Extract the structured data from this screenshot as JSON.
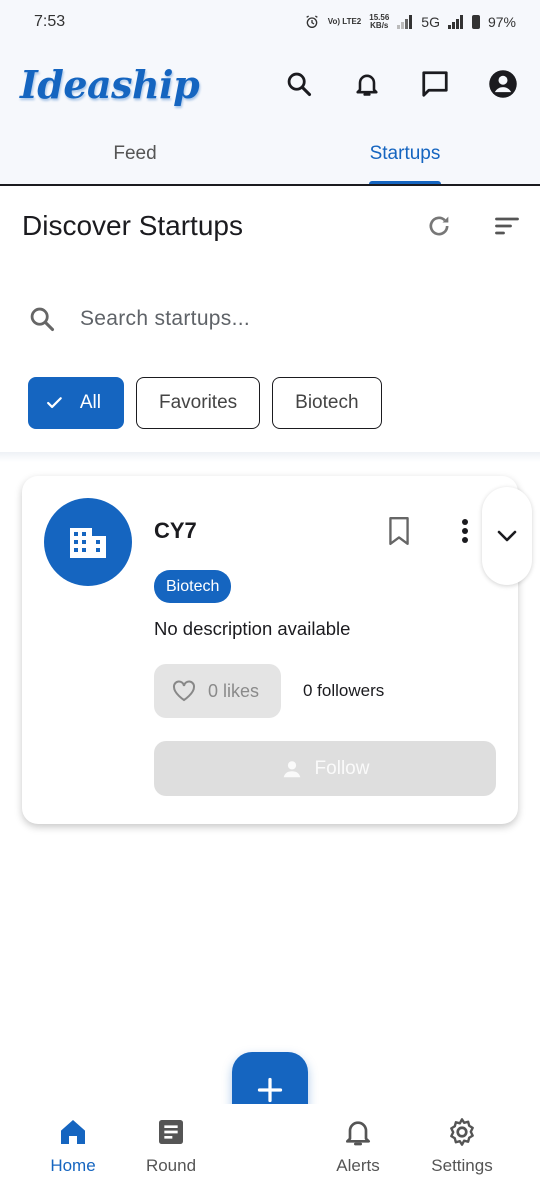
{
  "status_bar": {
    "time": "7:53",
    "network_label": "Vo) LTE2",
    "speed": "15.56",
    "speed_unit": "KB/s",
    "network_type": "5G",
    "battery": "97%"
  },
  "app": {
    "logo": "Ideaship",
    "actions": [
      "search-icon",
      "bell-icon",
      "chat-icon",
      "account-icon"
    ]
  },
  "tabs": [
    {
      "label": "Feed",
      "active": false
    },
    {
      "label": "Startups",
      "active": true
    }
  ],
  "page": {
    "title": "Discover Startups"
  },
  "search": {
    "placeholder": "Search startups..."
  },
  "filters": [
    {
      "label": "All",
      "selected": true
    },
    {
      "label": "Favorites",
      "selected": false
    },
    {
      "label": "Biotech",
      "selected": false
    }
  ],
  "startup_card": {
    "name": "CY7",
    "tag": "Biotech",
    "description": "No description available",
    "likes": "0 likes",
    "followers": "0 followers",
    "follow_label": "Follow"
  },
  "bottom_nav": [
    {
      "label": "Home",
      "icon": "home-icon",
      "active": true
    },
    {
      "label": "Round",
      "icon": "article-icon",
      "active": false
    },
    {
      "label": "Alerts",
      "icon": "bell-icon",
      "active": false
    },
    {
      "label": "Settings",
      "icon": "gear-icon",
      "active": false
    }
  ],
  "colors": {
    "primary": "#1565c0",
    "background": "#f6f8fc",
    "disabled": "#dedede"
  }
}
